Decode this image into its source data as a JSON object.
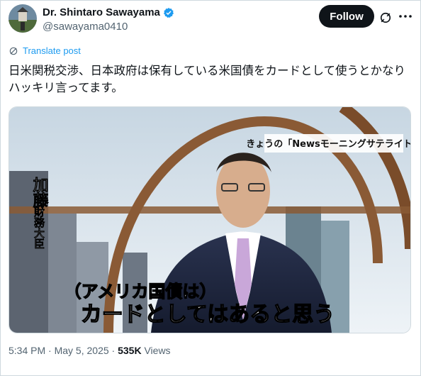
{
  "author": {
    "display_name": "Dr. Shintaro Sawayama",
    "handle": "@sawayama0410",
    "follow_label": "Follow"
  },
  "icons": {
    "verified": "verified-badge-icon",
    "grok": "grok-icon",
    "more": "more-options-icon",
    "translate": "translate-icon"
  },
  "translate_label": "Translate post",
  "tweet": {
    "text": "日米関税交渉、日本政府は保有している米国債をカードとして使うとかなりハッキリ言ってます。"
  },
  "video": {
    "corner_caption": "きょうの「Newsモーニングサテライト」",
    "side_name": "加藤",
    "side_title": "財務大臣",
    "subtitle_line1": "（アメリカ国債は）",
    "subtitle_line2": "カードとしてはあると思う"
  },
  "meta": {
    "time": "5:34 PM",
    "sep1": " · ",
    "date": "May 5, 2025",
    "sep2": " · ",
    "views_count": "535K",
    "views_label": " Views"
  },
  "colors": {
    "accent": "#1d9bf0",
    "text": "#0f1419",
    "muted": "#536471",
    "verified": "#1d9bf0"
  }
}
